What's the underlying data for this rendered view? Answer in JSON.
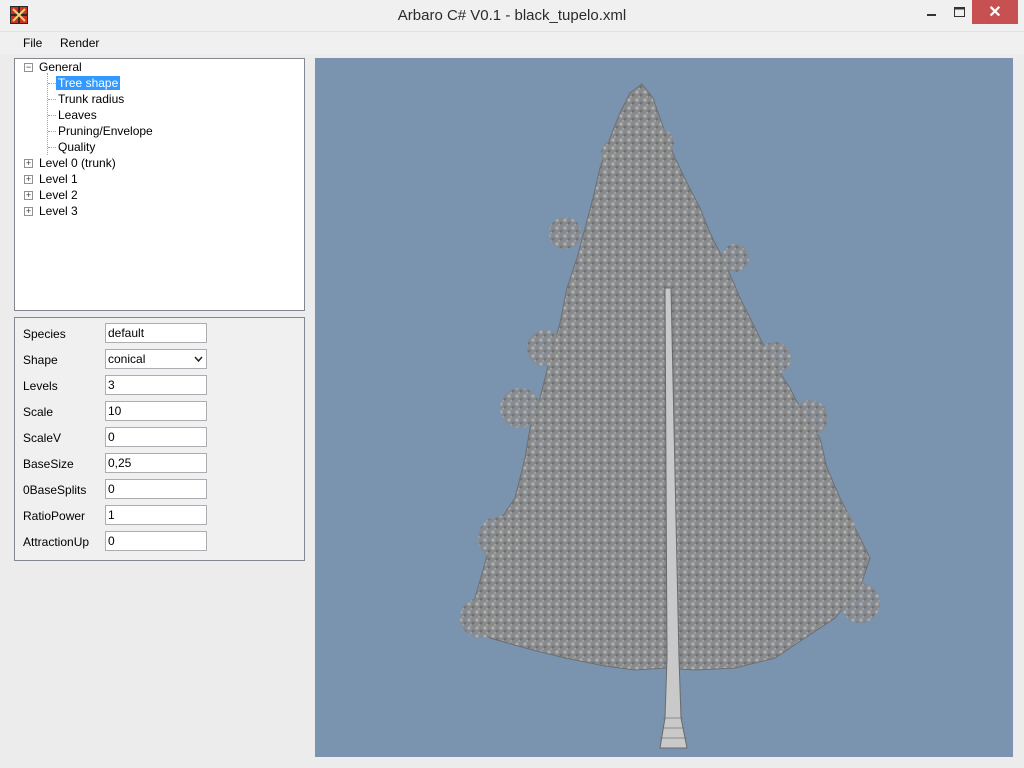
{
  "window": {
    "title": "Arbaro C# V0.1 - black_tupelo.xml",
    "close_glyph": "✕",
    "icon": "app-logo-icon"
  },
  "menu": {
    "items": [
      {
        "label": "File"
      },
      {
        "label": "Render"
      }
    ]
  },
  "tree": {
    "nodes": [
      {
        "label": "General",
        "expanded": true
      },
      {
        "label": "Tree shape",
        "selected": true
      },
      {
        "label": "Trunk radius"
      },
      {
        "label": "Leaves"
      },
      {
        "label": "Pruning/Envelope"
      },
      {
        "label": "Quality"
      },
      {
        "label": "Level 0 (trunk)",
        "expanded": false
      },
      {
        "label": "Level 1",
        "expanded": false
      },
      {
        "label": "Level 2",
        "expanded": false
      },
      {
        "label": "Level 3",
        "expanded": false
      }
    ]
  },
  "properties": [
    {
      "label": "Species",
      "value": "default"
    },
    {
      "label": "Shape",
      "value": "conical"
    },
    {
      "label": "Levels",
      "value": "3"
    },
    {
      "label": "Scale",
      "value": "10"
    },
    {
      "label": "ScaleV",
      "value": "0"
    },
    {
      "label": "BaseSize",
      "value": "0,25"
    },
    {
      "label": "0BaseSplits",
      "value": "0"
    },
    {
      "label": "RatioPower",
      "value": "1"
    },
    {
      "label": "AttractionUp",
      "value": "0"
    }
  ],
  "viewport": {
    "background": "#7a93ae",
    "content": "tree-render"
  },
  "colors": {
    "selection": "#3399ff",
    "close_button": "#c75050"
  }
}
